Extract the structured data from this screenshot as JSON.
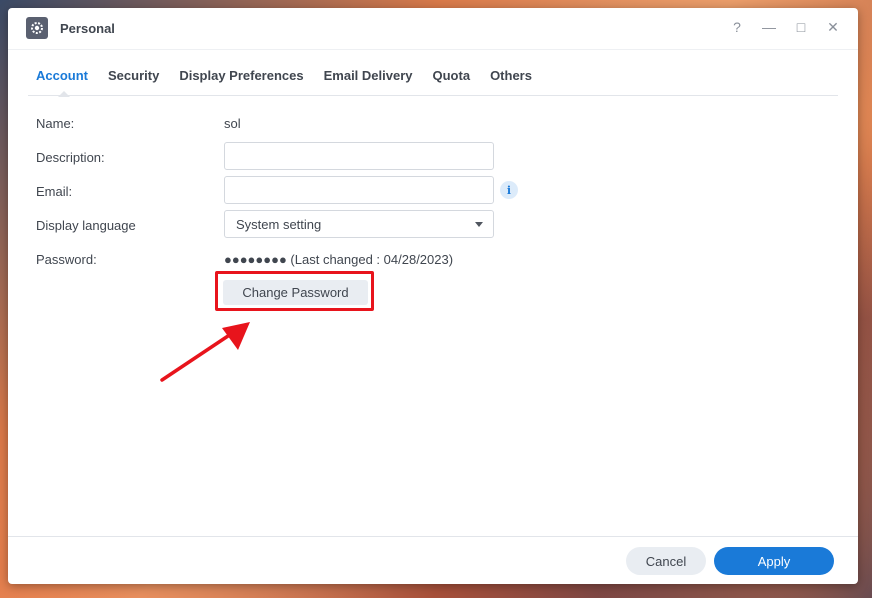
{
  "window": {
    "title": "Personal",
    "controls": {
      "help": "?",
      "minimize": "—",
      "maximize": "□",
      "close": "✕"
    }
  },
  "tabs": [
    {
      "label": "Account",
      "active": true
    },
    {
      "label": "Security",
      "active": false
    },
    {
      "label": "Display Preferences",
      "active": false
    },
    {
      "label": "Email Delivery",
      "active": false
    },
    {
      "label": "Quota",
      "active": false
    },
    {
      "label": "Others",
      "active": false
    }
  ],
  "form": {
    "name_label": "Name:",
    "name_value": "sol",
    "description_label": "Description:",
    "description_value": "",
    "email_label": "Email:",
    "email_value": "",
    "language_label": "Display language",
    "language_value": "System setting",
    "password_label": "Password:",
    "password_value": "●●●●●●●● (Last changed : 04/28/2023)",
    "change_password_label": "Change Password"
  },
  "footer": {
    "cancel_label": "Cancel",
    "apply_label": "Apply"
  },
  "colors": {
    "accent": "#1a7ad8",
    "highlight": "#e8141c"
  }
}
